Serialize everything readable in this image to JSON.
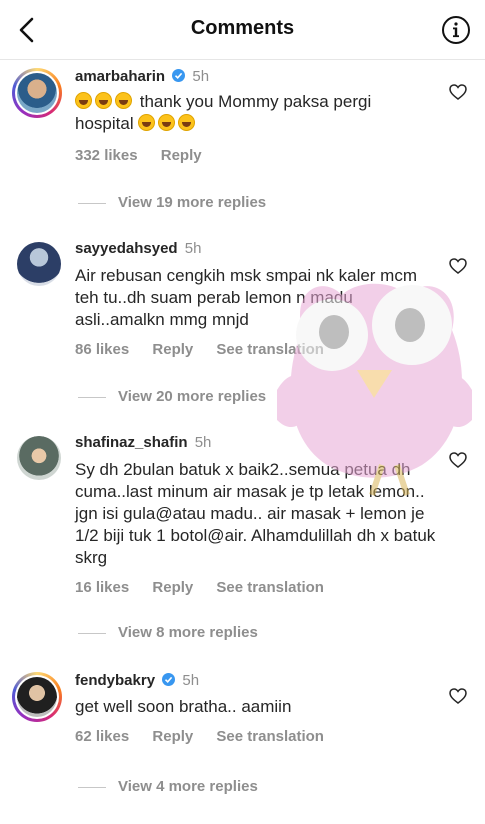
{
  "header": {
    "title": "Comments",
    "back_icon": "chevron-left-icon",
    "info_icon": "info-circle-icon"
  },
  "comments": [
    {
      "username": "amarbaharin",
      "verified": true,
      "time": "5h",
      "text_pre": "",
      "text_mid": "thank you Mommy paksa pergi",
      "text_line2": "hospital",
      "likes": "332 likes",
      "reply": "Reply",
      "translation": "",
      "view_replies": "View 19 more replies"
    },
    {
      "username": "sayyedahsyed",
      "verified": false,
      "time": "5h",
      "text": "Air rebusan cengkih msk smpai nk kaler mcm teh tu..dh suam perab lemon n madu asli..amalkn mmg mnjd",
      "likes": "86 likes",
      "reply": "Reply",
      "translation": "See translation",
      "view_replies": "View 20 more replies"
    },
    {
      "username": "shafinaz_shafin",
      "verified": false,
      "time": "5h",
      "text": "Sy dh 2bulan batuk x baik2..semua petua dh cuma..last minum air masak je tp letak lemon.. jgn isi gula@atau madu.. air masak + lemon je 1/2 biji tuk 1 botol@air. Alhamdulillah dh x batuk skrg",
      "likes": "16 likes",
      "reply": "Reply",
      "translation": "See translation",
      "view_replies": "View 8 more replies"
    },
    {
      "username": "fendybakry",
      "verified": true,
      "time": "5h",
      "text": "get well soon bratha.. aamiin",
      "likes": "62 likes",
      "reply": "Reply",
      "translation": "See translation",
      "view_replies": "View 4 more replies"
    }
  ],
  "colors": {
    "verified": "#3897f0",
    "muted": "#8e8e8e",
    "text": "#262626"
  }
}
